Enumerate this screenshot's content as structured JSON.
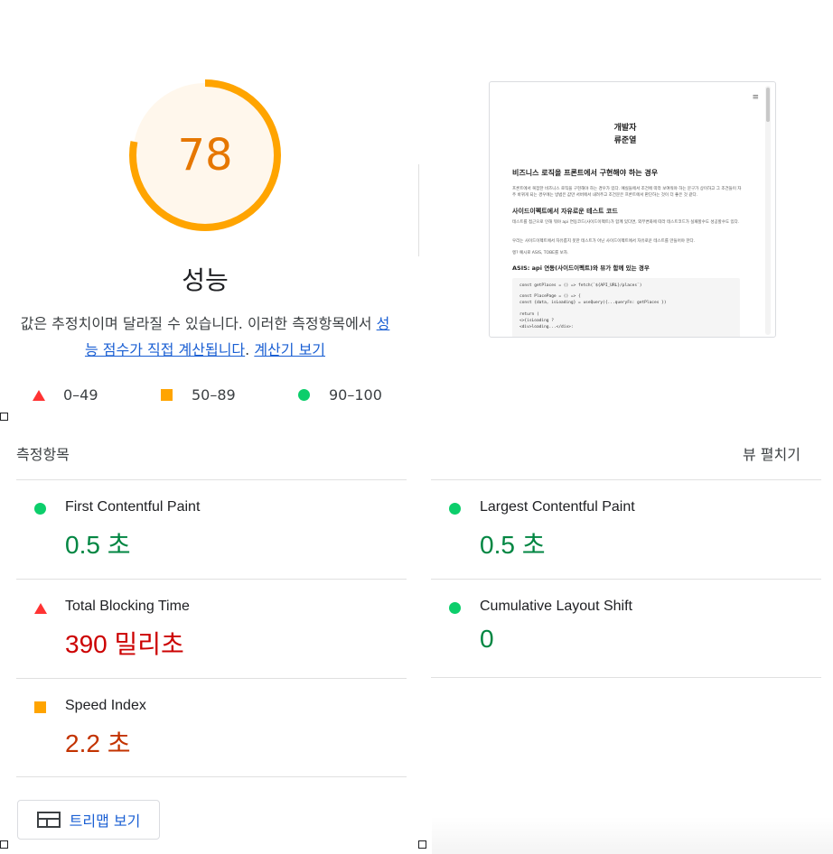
{
  "score": {
    "value": "78",
    "fraction": 0.78,
    "color": "#ffa400"
  },
  "title": "성능",
  "description": {
    "text": "값은 추정치이며 달라질 수 있습니다. 이러한 측정항목에서 ",
    "link1": "성능 점수가 직접 계산됩니다",
    "sep": ". ",
    "link2": "계산기 보기"
  },
  "legend": [
    {
      "icon": "fail-triangle-icon",
      "label": "0–49",
      "color": "#ff3333"
    },
    {
      "icon": "average-square-icon",
      "label": "50–89",
      "color": "#ffa400"
    },
    {
      "icon": "pass-circle-icon",
      "label": "90–100",
      "color": "#0cce6b"
    }
  ],
  "metrics_header": {
    "title": "측정항목",
    "expand_label": "뷰 펼치기"
  },
  "metrics": [
    {
      "name": "First Contentful Paint",
      "value": "0.5 초",
      "status": "pass"
    },
    {
      "name": "Largest Contentful Paint",
      "value": "0.5 초",
      "status": "pass"
    },
    {
      "name": "Total Blocking Time",
      "value": "390 밀리초",
      "status": "fail"
    },
    {
      "name": "Cumulative Layout Shift",
      "value": "0",
      "status": "pass"
    },
    {
      "name": "Speed Index",
      "value": "2.2 초",
      "status": "average"
    }
  ],
  "treemap_button": "트리맵 보기",
  "screenshot": {
    "menu": "≡",
    "author_title": "개발자",
    "author_name": "류준열",
    "h1": "비즈니스 로직을 프론트에서 구현해야 하는 경우",
    "p1": "프론트에서 복잡한 비즈니스 로직을 구현해야 하는 경우가 있다. 예실들에서 조건에 따라 보여줘야 하는 문구가 상이하고 그 조건들이 자주 바뀌게 되는 경우에는 방법은 값만 서버에서 내려주고 조건문은 프론트에서 판단하는 것이 더 좋은 것 같다.",
    "h2": "사이드이펙트에서 자유로운 테스트 코드",
    "p2": "테스트를 접근으로 인해 뭐야 api 연동코드(사이드이펙트)가 함께 있다면, 외부변화에 따라 테스트코드가 실패할수도 성공할수도 있다.",
    "p3": "우리는 사이드이펙트에서 자유롭지 못한 테스트가 아닌 사이드이펙트에서 자유로운 테스트를 만들어야 한다.",
    "p4": "엥? 예시로 ASIS, TOBE를 보자.",
    "h3": "ASIS: api 연동(사이드이펙트)와 뷰가 함께 있는 경우",
    "code": [
      "const getPlaces = () => fetch(`${API_URL}/places`)",
      "const PlacePage = () => {",
      "  const {data, isLoading} = useQuery({...queryFn: getPlaces })",
      "  return (",
      "  <>{isLoading ?",
      "    <div>loading...</div>:"
    ]
  }
}
